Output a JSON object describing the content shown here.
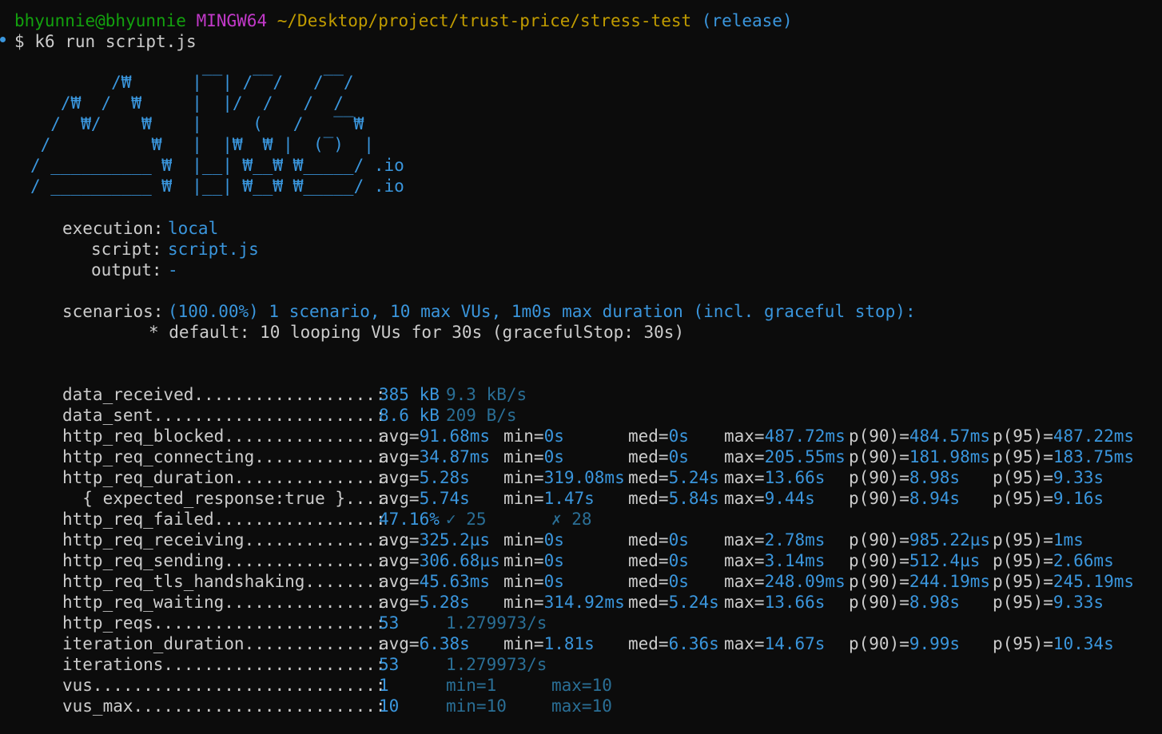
{
  "prompt": {
    "user": "bhyunnie@bhyunnie",
    "system": "MINGW64",
    "path": "~/Desktop/project/trust-price/stress-test",
    "branch": "(release)",
    "dollar": "$",
    "command": "k6 run script.js"
  },
  "logo": "        /₩      |‾‾| /‾‾/   /‾‾/\n   /₩  /  ₩     |  |/  /   /  /\n  /  ₩/    ₩    |     (   /   ‾‾₩\n /          ₩   |  |₩  ₩ |  (‾)  |\n/ __________ ₩  |__| ₩__₩ ₩_____/ .io\n/ __________ ₩  |__| ₩__₩ ₩_____/ .io",
  "options": {
    "execution_label": "execution:",
    "execution_value": "local",
    "script_label": "script:",
    "script_value": "script.js",
    "output_label": "output:",
    "output_value": "-",
    "scenarios_label": "scenarios:",
    "scenarios_value": "(100.00%) 1 scenario, 10 max VUs, 1m0s max duration (incl. graceful stop):",
    "scenario_detail": "* default: 10 looping VUs for 30s (gracefulStop: 30s)"
  },
  "metrics": [
    {
      "name": "data_received",
      "dots": "..................:",
      "cols": [
        {
          "text": "385 kB",
          "tone": "c"
        },
        {
          "text": "9.3 kB/s",
          "tone": "d"
        }
      ]
    },
    {
      "name": "data_sent",
      "dots": "......................:",
      "cols": [
        {
          "text": "8.6 kB",
          "tone": "c"
        },
        {
          "text": "209 B/s",
          "tone": "d"
        }
      ]
    },
    {
      "name": "http_req_blocked",
      "dots": "...............:",
      "cols": [
        {
          "k": "avg=",
          "v": "91.68ms"
        },
        {
          "k": "min=",
          "v": "0s"
        },
        {
          "k": "med=",
          "v": "0s"
        },
        {
          "k": "max=",
          "v": "487.72ms"
        },
        {
          "k": "p(90)=",
          "v": "484.57ms"
        },
        {
          "k": "p(95)=",
          "v": "487.22ms"
        }
      ]
    },
    {
      "name": "http_req_connecting",
      "dots": "............:",
      "cols": [
        {
          "k": "avg=",
          "v": "34.87ms"
        },
        {
          "k": "min=",
          "v": "0s"
        },
        {
          "k": "med=",
          "v": "0s"
        },
        {
          "k": "max=",
          "v": "205.55ms"
        },
        {
          "k": "p(90)=",
          "v": "181.98ms"
        },
        {
          "k": "p(95)=",
          "v": "183.75ms"
        }
      ]
    },
    {
      "name": "http_req_duration",
      "dots": "..............:",
      "cols": [
        {
          "k": "avg=",
          "v": "5.28s"
        },
        {
          "k": "min=",
          "v": "319.08ms"
        },
        {
          "k": "med=",
          "v": "5.24s"
        },
        {
          "k": "max=",
          "v": "13.66s"
        },
        {
          "k": "p(90)=",
          "v": "8.98s"
        },
        {
          "k": "p(95)=",
          "v": "9.33s"
        }
      ]
    },
    {
      "name": "  { expected_response:true }",
      "dots": "...:",
      "cols": [
        {
          "k": "avg=",
          "v": "5.74s"
        },
        {
          "k": "min=",
          "v": "1.47s"
        },
        {
          "k": "med=",
          "v": "5.84s"
        },
        {
          "k": "max=",
          "v": "9.44s"
        },
        {
          "k": "p(90)=",
          "v": "8.94s"
        },
        {
          "k": "p(95)=",
          "v": "9.16s"
        }
      ]
    },
    {
      "name": "http_req_failed",
      "dots": "................:",
      "cols": [
        {
          "text": "47.16%",
          "tone": "c"
        },
        {
          "text": "✓ 25",
          "tone": "d"
        },
        {
          "text": "✗ 28",
          "tone": "d"
        }
      ]
    },
    {
      "name": "http_req_receiving",
      "dots": ".............:",
      "cols": [
        {
          "k": "avg=",
          "v": "325.2µs"
        },
        {
          "k": "min=",
          "v": "0s"
        },
        {
          "k": "med=",
          "v": "0s"
        },
        {
          "k": "max=",
          "v": "2.78ms"
        },
        {
          "k": "p(90)=",
          "v": "985.22µs"
        },
        {
          "k": "p(95)=",
          "v": "1ms"
        }
      ]
    },
    {
      "name": "http_req_sending",
      "dots": "...............:",
      "cols": [
        {
          "k": "avg=",
          "v": "306.68µs"
        },
        {
          "k": "min=",
          "v": "0s"
        },
        {
          "k": "med=",
          "v": "0s"
        },
        {
          "k": "max=",
          "v": "3.14ms"
        },
        {
          "k": "p(90)=",
          "v": "512.4µs"
        },
        {
          "k": "p(95)=",
          "v": "2.66ms"
        }
      ]
    },
    {
      "name": "http_req_tls_handshaking",
      "dots": ".......:",
      "cols": [
        {
          "k": "avg=",
          "v": "45.63ms"
        },
        {
          "k": "min=",
          "v": "0s"
        },
        {
          "k": "med=",
          "v": "0s"
        },
        {
          "k": "max=",
          "v": "248.09ms"
        },
        {
          "k": "p(90)=",
          "v": "244.19ms"
        },
        {
          "k": "p(95)=",
          "v": "245.19ms"
        }
      ]
    },
    {
      "name": "http_req_waiting",
      "dots": "...............:",
      "cols": [
        {
          "k": "avg=",
          "v": "5.28s"
        },
        {
          "k": "min=",
          "v": "314.92ms"
        },
        {
          "k": "med=",
          "v": "5.24s"
        },
        {
          "k": "max=",
          "v": "13.66s"
        },
        {
          "k": "p(90)=",
          "v": "8.98s"
        },
        {
          "k": "p(95)=",
          "v": "9.33s"
        }
      ]
    },
    {
      "name": "http_reqs",
      "dots": "......................:",
      "cols": [
        {
          "text": "53",
          "tone": "c"
        },
        {
          "text": "1.279973/s",
          "tone": "d"
        }
      ]
    },
    {
      "name": "iteration_duration",
      "dots": ".............:",
      "cols": [
        {
          "k": "avg=",
          "v": "6.38s"
        },
        {
          "k": "min=",
          "v": "1.81s"
        },
        {
          "k": "med=",
          "v": "6.36s"
        },
        {
          "k": "max=",
          "v": "14.67s"
        },
        {
          "k": "p(90)=",
          "v": "9.99s"
        },
        {
          "k": "p(95)=",
          "v": "10.34s"
        }
      ]
    },
    {
      "name": "iterations",
      "dots": ".....................:",
      "cols": [
        {
          "text": "53",
          "tone": "c"
        },
        {
          "text": "1.279973/s",
          "tone": "d"
        }
      ]
    },
    {
      "name": "vus",
      "dots": "............................:",
      "cols": [
        {
          "text": "1",
          "tone": "c"
        },
        {
          "text": "min=1",
          "tone": "d"
        },
        {
          "text": "max=10",
          "tone": "d"
        }
      ]
    },
    {
      "name": "vus_max",
      "dots": "........................:",
      "cols": [
        {
          "text": "10",
          "tone": "c"
        },
        {
          "text": "min=10",
          "tone": "d"
        },
        {
          "text": "max=10",
          "tone": "d"
        }
      ]
    }
  ]
}
